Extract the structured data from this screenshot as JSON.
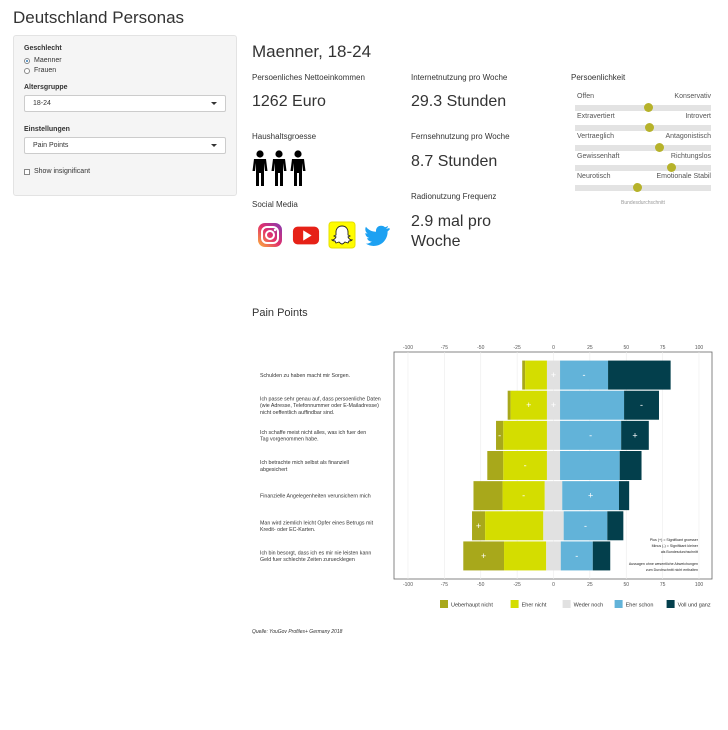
{
  "app": {
    "title": "Deutschland Personas"
  },
  "sidebar": {
    "gender": {
      "label": "Geschlecht",
      "options": [
        "Maenner",
        "Frauen"
      ],
      "selected": 0
    },
    "age": {
      "label": "Altersgruppe",
      "value": "18-24"
    },
    "settings": {
      "label": "Einstellungen",
      "value": "Pain Points"
    },
    "insignificant": {
      "label": "Show insignificant",
      "checked": false
    }
  },
  "persona": {
    "title": "Maenner, 18-24",
    "income": {
      "label": "Persoenliches Nettoeinkommen",
      "value": "1262 Euro"
    },
    "internet": {
      "label": "Internetnutzung pro Woche",
      "value": "29.3 Stunden"
    },
    "household": {
      "label": "Haushaltsgroesse",
      "size": 3,
      "icon": "person-icon"
    },
    "tv": {
      "label": "Fernsehnutzung pro Woche",
      "value": "8.7 Stunden"
    },
    "social": {
      "label": "Social Media",
      "icons": [
        "instagram-icon",
        "youtube-icon",
        "snapchat-icon",
        "twitter-icon"
      ]
    },
    "radio": {
      "label": "Radionutzung Frequenz",
      "value_line1": "2.9 mal pro",
      "value_line2": "Woche"
    }
  },
  "personality": {
    "title": "Persoenlichkeit",
    "footnote": "Bundesdurchschnitt",
    "dot_color": "#b6b22a",
    "traits": [
      {
        "left": "Offen",
        "right": "Konservativ",
        "value": 0.54
      },
      {
        "left": "Extravertiert",
        "right": "Introvert",
        "value": 0.55
      },
      {
        "left": "Vertraeglich",
        "right": "Antagonistisch",
        "value": 0.62
      },
      {
        "left": "Gewissenhaft",
        "right": "Richtungslos",
        "value": 0.71
      },
      {
        "left": "Neurotisch",
        "right": "Emotionale Stabil",
        "value": 0.46
      }
    ]
  },
  "pain_points": {
    "title": "Pain Points",
    "source": "Quelle: YouGov Profiles+ Germany 2018"
  },
  "chart_data": {
    "type": "bar",
    "orientation": "horizontal-diverging",
    "xlim": [
      -100,
      100
    ],
    "ticks": [
      -100,
      -75,
      -50,
      -25,
      0,
      25,
      50,
      75,
      100
    ],
    "categories": [
      "Schulden zu haben macht mir Sorgen.",
      "Ich passe sehr genau auf, dass persoenliche Daten (wie Adresse, Telefonnummer oder E-Mailadresse) nicht oeffentlich auffindbar sind.",
      "Ich schaffe meist nicht alles, was ich fuer den Tag vorgenommen habe.",
      "Ich betrachte mich selbst als finanziell abgesichert",
      "Finanzielle Angelegenheiten verunsichern mich",
      "Man wird ziemlich leicht Opfer eines Betrugs mit Kredit- oder EC-Karten.",
      "Ich bin besorgt, dass ich es mir nie leisten kann Geld fuer schlechte Zeiten zuruecklegen"
    ],
    "label_lines": [
      [
        "Schulden zu haben macht mir Sorgen."
      ],
      [
        "Ich passe sehr genau auf, dass persoenliche Daten",
        "(wie Adresse, Telefonnummer oder E-Mailadresse)",
        "nicht oeffentlich auffindbar sind."
      ],
      [
        "Ich schaffe meist nicht alles, was ich fuer den",
        "Tag vorgenommen habe."
      ],
      [
        "Ich betrachte mich selbst als finanziell",
        "abgesichert"
      ],
      [
        "Finanzielle Angelegenheiten verunsichern mich"
      ],
      [
        "Man wird ziemlich leicht Opfer eines Betrugs mit",
        "Kredit- oder EC-Karten."
      ],
      [
        "Ich bin besorgt, dass ich es mir nie leisten kann",
        "Geld fuer schlechte Zeiten zuruecklegen"
      ]
    ],
    "series": [
      {
        "name": "Ueberhaupt nicht",
        "color": "#a8a81b",
        "values": [
          2,
          2,
          5,
          11,
          20,
          9,
          28
        ],
        "marks": [
          "",
          "",
          "-",
          "",
          "",
          "+",
          "+"
        ]
      },
      {
        "name": "Eher nicht",
        "color": "#d4dd00",
        "values": [
          15,
          25,
          30,
          30,
          29,
          40,
          29
        ],
        "marks": [
          "",
          "+",
          "",
          "-",
          "-",
          "",
          ""
        ]
      },
      {
        "name": "Weder noch",
        "color": "#e1e1e1",
        "values": [
          9,
          9,
          9,
          9,
          12,
          14,
          10
        ],
        "marks": [
          "+",
          "+",
          "",
          "",
          "",
          "",
          ""
        ]
      },
      {
        "name": "Eher schon",
        "color": "#62b3d9",
        "values": [
          33,
          44,
          42,
          41,
          39,
          30,
          22
        ],
        "marks": [
          "-",
          "",
          "-",
          "",
          "+",
          "-",
          "-"
        ]
      },
      {
        "name": "Voll und ganz",
        "color": "#033f4c",
        "values": [
          43,
          24,
          19,
          15,
          7,
          11,
          12
        ],
        "marks": [
          "",
          "-",
          "+",
          "",
          "",
          "",
          ""
        ]
      }
    ],
    "legend_position": "bottom",
    "annotation": [
      "Plus (+) = Signifikant groesser",
      "Minus (-) = Signifikant kleiner",
      "als Bundesdurchschnitt",
      "",
      "Aussagen ohne wesentliche Abweichungen",
      "zum Durchschnitt nicht enthalten"
    ]
  }
}
